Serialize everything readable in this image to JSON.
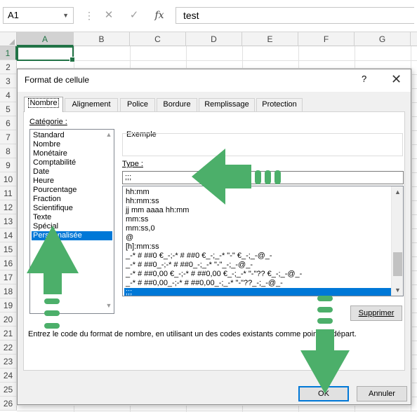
{
  "formula_bar": {
    "name_box": "A1",
    "cancel_glyph": "✕",
    "enter_glyph": "✓",
    "fx_label": "fx",
    "content": "test"
  },
  "columns": [
    "A",
    "B",
    "C",
    "D",
    "E",
    "F",
    "G"
  ],
  "rows": [
    "1",
    "2",
    "3",
    "4",
    "5",
    "6",
    "7",
    "8",
    "9",
    "10",
    "11",
    "12",
    "13",
    "14",
    "15",
    "16",
    "17",
    "18",
    "19",
    "20",
    "21",
    "22",
    "23",
    "24",
    "25",
    "26"
  ],
  "dialog": {
    "title": "Format de cellule",
    "help": "?",
    "close": "✕",
    "tabs": [
      "Nombre",
      "Alignement",
      "Police",
      "Bordure",
      "Remplissage",
      "Protection"
    ],
    "active_tab": "Nombre",
    "category_label": "Catégorie :",
    "categories": [
      "Standard",
      "Nombre",
      "Monétaire",
      "Comptabilité",
      "Date",
      "Heure",
      "Pourcentage",
      "Fraction",
      "Scientifique",
      "Texte",
      "Spécial",
      "Personnalisée"
    ],
    "selected_category": "Personnalisée",
    "example_label": "Exemple",
    "type_label": "Type :",
    "type_value": ";;;",
    "formats": [
      "hh:mm",
      "hh:mm:ss",
      "jj mm aaaa hh:mm",
      "mm:ss",
      "mm:ss,0",
      "@",
      "[h]:mm:ss",
      "_-* # ##0 €_-;-* # ##0 €_-;_-* \"-\" €_-;_-@_-",
      "_-* # ##0_-;-* # ##0_-;_-* \"-\"_-;_-@_-",
      "_-* # ##0,00 €_-;-* # ##0,00 €_-;_-* \"-\"?? €_-;_-@_-",
      "_-* # ##0,00_-;-* # ##0,00_-;_-* \"-\"??_-;_-@_-",
      ";;;"
    ],
    "selected_format": ";;;",
    "delete_button": "Supprimer",
    "help_text": "Entrez le code du format de nombre, en utilisant un des codes existants comme point de départ.",
    "ok_button": "OK",
    "cancel_button": "Annuler"
  },
  "annotation_color": "#4caf6a",
  "accent_color": "#217346",
  "selection_color": "#0078d7"
}
